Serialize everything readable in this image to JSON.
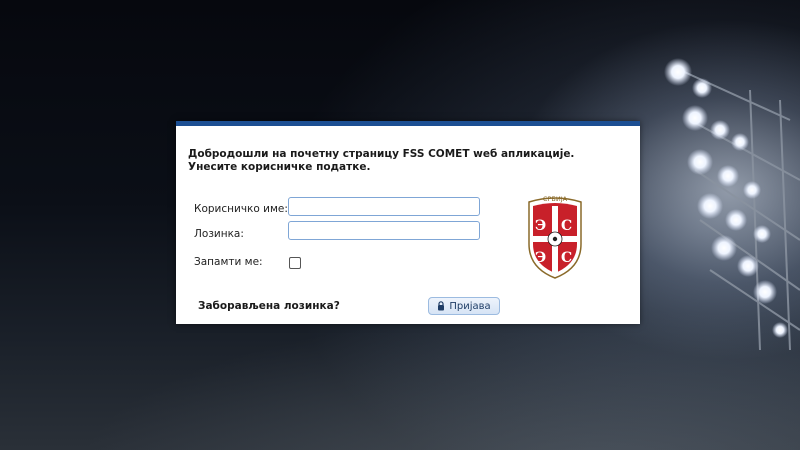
{
  "dialog": {
    "welcome_text": "Добродошли на почетну страницу FSS COMET weб апликације. Унесите корисничке податке.",
    "username_label": "Корисничко име:",
    "username_value": "",
    "password_label": "Лозинка:",
    "password_value": "",
    "remember_label": "Запамти ме:",
    "remember_checked": false,
    "forgot_password": "Заборављена лозинка?",
    "login_button": "Пријава"
  },
  "crest": {
    "text": "СРБИЈА"
  },
  "colors": {
    "accent": "#1c4f93",
    "crest_red": "#c8202a"
  }
}
